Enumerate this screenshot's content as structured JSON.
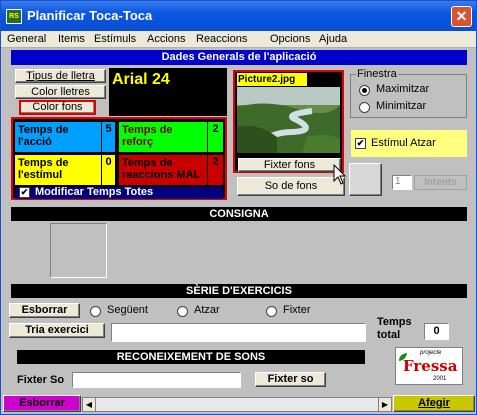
{
  "window": {
    "title": "Planificar Toca-Toca",
    "icon_text": "RS"
  },
  "menu": [
    "General",
    "Items",
    "Estímuls",
    "Accions",
    "Reaccions",
    "Opcions",
    "Ajuda"
  ],
  "general_header": "Dades Generals de l'aplicació",
  "font_buttons": {
    "font_type": "Tipus de lletra",
    "font_color": "Color lletres",
    "bg_color": "Color fons"
  },
  "font_preview": "Arial 24",
  "timers": [
    {
      "label": "Temps de l'acció",
      "value": "5",
      "color": "#00a0ff"
    },
    {
      "label": "Temps de reforç",
      "value": "2",
      "color": "#00ff00"
    },
    {
      "label": "Temps de l'estímul",
      "value": "0",
      "color": "#ffff00"
    },
    {
      "label": "Temps de reaccions MAL",
      "value": "2",
      "color": "#c80000"
    }
  ],
  "modify_all": {
    "label": "Modificar Temps Totes",
    "checked": true
  },
  "picture": {
    "filename": "Picture2.jpg",
    "set_bg": "Fixter fons",
    "is_bg": "So de fons"
  },
  "window_group": {
    "title": "Finestra",
    "options": [
      "Maximitzar",
      "Minimitzar"
    ],
    "selected": 0
  },
  "random_stim": {
    "label": "Estímul Atzar",
    "checked": true
  },
  "attempts": {
    "value": "1",
    "label": "Intents"
  },
  "consigna_header": "CONSIGNA",
  "series_header": "SÈRIE D'EXERCICIS",
  "series": {
    "clear": "Esborrar",
    "options": [
      "Següent",
      "Atzar",
      "Fixter"
    ],
    "choose": "Tria exercici",
    "total_label_1": "Temps",
    "total_label_2": "total",
    "total_value": "0"
  },
  "sound_header": "RECONEIXEMENT DE SONS",
  "sound": {
    "label": "Fixter So",
    "button": "Fixter so"
  },
  "logo": {
    "top": "projecte",
    "name": "Fressa",
    "year": "2001"
  },
  "bottom": {
    "clear": "Esborrar",
    "add": "Afegir"
  }
}
